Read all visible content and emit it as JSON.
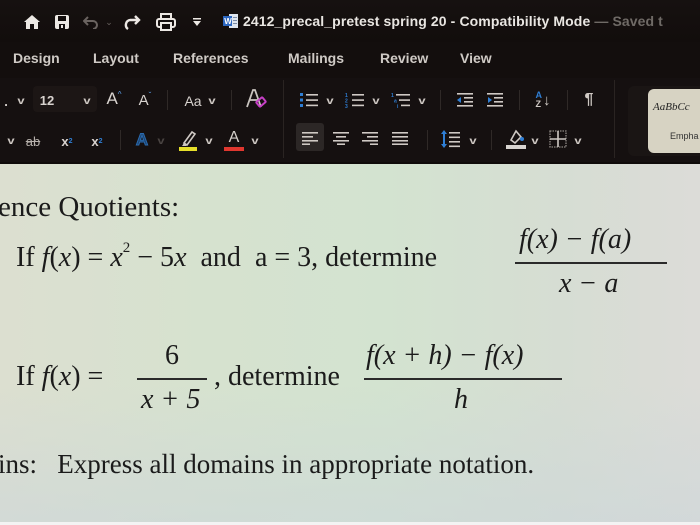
{
  "titlebar": {
    "icons": [
      "home-icon",
      "save-icon",
      "undo-icon",
      "redo-icon",
      "print-icon",
      "customize-toolbar-icon",
      "word-document-icon"
    ],
    "document_name": "2412_precal_pretest spring 20",
    "separator": " - ",
    "mode": "Compatibility Mode",
    "save_status": "— Saved t"
  },
  "tabs": [
    {
      "label": "Design"
    },
    {
      "label": "Layout"
    },
    {
      "label": "References"
    },
    {
      "label": "Mailings"
    },
    {
      "label": "Review"
    },
    {
      "label": "View"
    }
  ],
  "ribbon": {
    "font_size": "12",
    "grow_font_label": "A",
    "shrink_font_label": "A",
    "change_case_label": "Aa",
    "subscript_label": "x",
    "subscript_mark": "2",
    "superscript_label": "x",
    "superscript_mark": "2",
    "strikethrough_label": "ab",
    "font_color_label": "A",
    "text_effects_label": "A",
    "highlight_color": "#e6df2a",
    "font_color": "#e0372f",
    "accent_blue": "#2f7fd6",
    "clear_format_accent": "#c640c6",
    "sort_label_top": "A",
    "sort_label_bottom": "Z",
    "pilcrow": "¶",
    "style_sample": "AaBbCc",
    "style_name": "Empha"
  },
  "document": {
    "heading": "ence Quotients:",
    "problem1": {
      "if": "If",
      "f": "f",
      "fx_arg": "(x)",
      "equals": "=",
      "x": "x",
      "exp": "2",
      "minus_5x": "− 5",
      "x2": "x",
      "and": "and",
      "a_eq": "a = 3, determine",
      "numerator": "f(x) − f(a)",
      "denominator": "x − a"
    },
    "problem2": {
      "if": "If",
      "f": "f",
      "fx_arg": "(x)",
      "equals": "=",
      "frac_num": "6",
      "frac_den": "x + 5",
      "comma": ",",
      "determine": "determine",
      "numerator": "f(x + h) − f(x)",
      "denominator": "h"
    },
    "domains_label": "ins:",
    "domains_text": "Express all domains in appropriate notation."
  }
}
